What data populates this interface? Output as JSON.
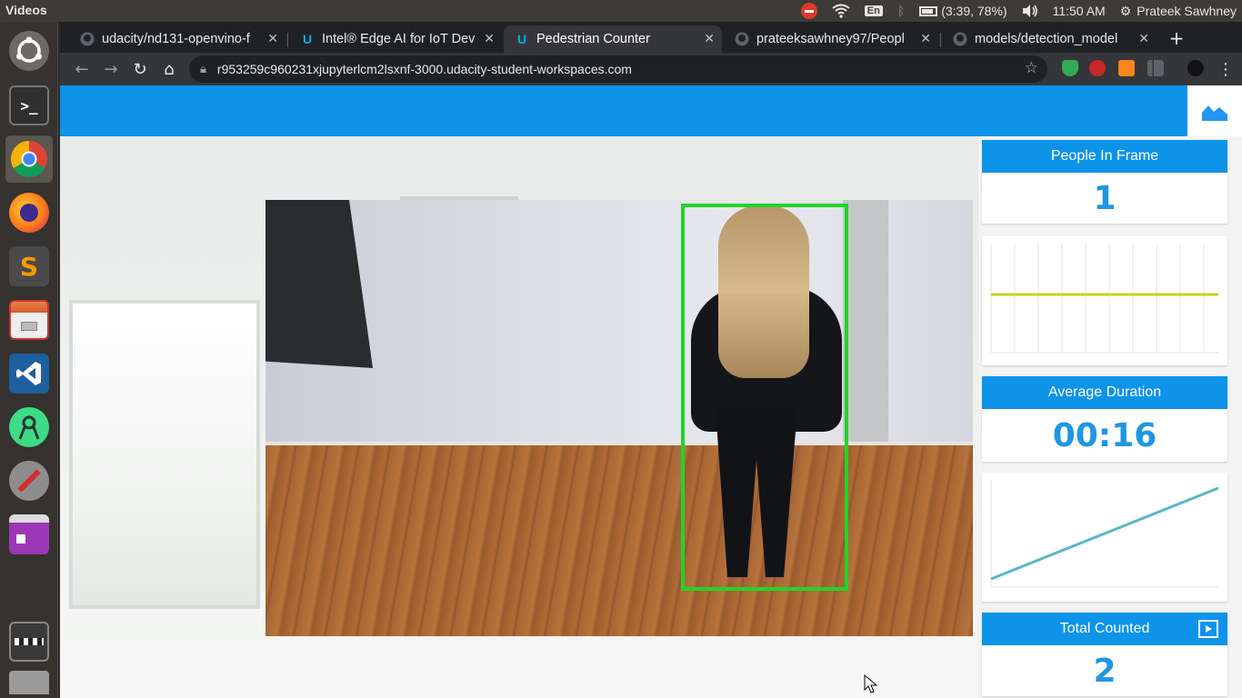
{
  "system": {
    "app_title": "Videos",
    "battery_text": "(3:39, 78%)",
    "input_lang": "En",
    "clock": "11:50 AM",
    "user": "Prateek Sawhney"
  },
  "launcher": {
    "icons": [
      "ubuntu-dash-icon",
      "terminal-icon",
      "chrome-icon",
      "firefox-icon",
      "sublime-text-icon",
      "files-icon",
      "vscode-icon",
      "android-studio-icon",
      "settings-tools-icon",
      "app-icon",
      "cubes-icon",
      "video-editor-icon",
      "scanner-icon"
    ]
  },
  "tabs": [
    {
      "label": "udacity/nd131-openvino-f",
      "icon": "github-icon"
    },
    {
      "label": "Intel® Edge AI for IoT Dev",
      "icon": "udacity-icon"
    },
    {
      "label": "Pedestrian Counter",
      "icon": "udacity-icon"
    },
    {
      "label": "prateeksawhney97/Peopl",
      "icon": "github-icon"
    },
    {
      "label": "models/detection_model",
      "icon": "github-icon"
    }
  ],
  "omnibox": {
    "url": "r953259c960231xjupyterlcm2lsxnf-3000.udacity-student-workspaces.com"
  },
  "app": {
    "people_in_frame_label": "People In Frame",
    "people_in_frame_value": "1",
    "average_duration_label": "Average Duration",
    "average_duration_value": "00:16",
    "total_counted_label": "Total Counted",
    "total_counted_value": "2"
  },
  "colors": {
    "accent": "#0d93e8",
    "value_text": "#1f96e2",
    "bbox": "#22d32a",
    "line_chart_1": "#c3d31e",
    "line_chart_2": "#5ab7c8"
  }
}
